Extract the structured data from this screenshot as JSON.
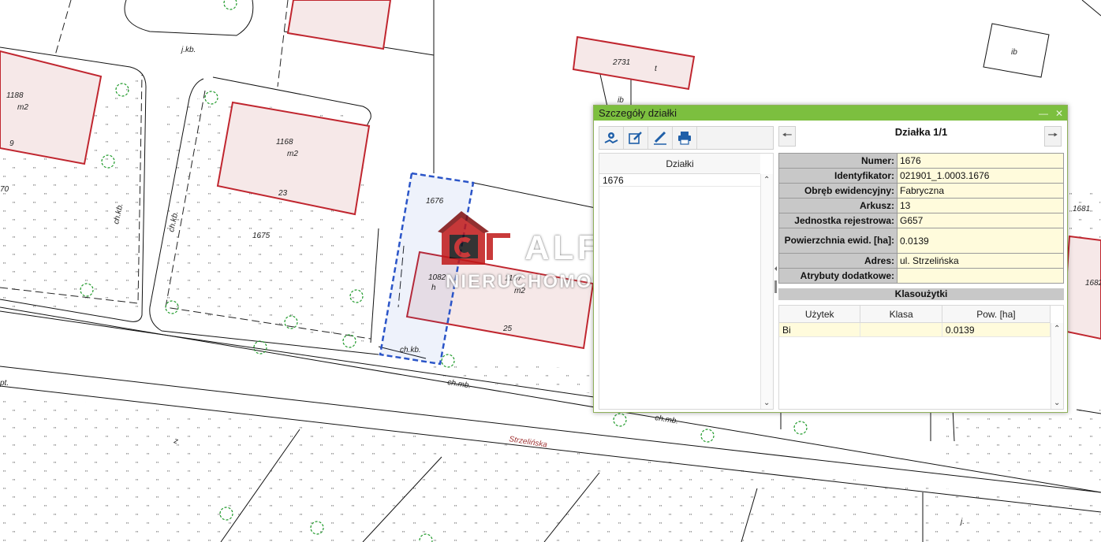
{
  "map": {
    "labels": {
      "jkb": "j.kb.",
      "p1188": "1188",
      "m2a": "m2",
      "n9": "9",
      "n70": "70",
      "p1168": "1168",
      "m2b": "m2",
      "n23": "23",
      "p1675": "1675",
      "chkb1": "ch.kb.",
      "chkb2": "ch.kb.",
      "p1676": "1676",
      "p1082": "1082",
      "h": "h",
      "p1167": "1167",
      "m2c": "m2",
      "n25": "25",
      "chkb3": "ch.kb.",
      "chmb1": "ch.mb.",
      "chmb2": "ch.mb.",
      "p2731": "2731",
      "t": "t",
      "ib1": "ib",
      "ib2": "ib",
      "p1681": "1681",
      "p1682": "1682",
      "pt": "pt.",
      "z": "z",
      "street": "Strzelińska",
      "j": "j."
    },
    "colors": {
      "building_fill": "#f6e8e8",
      "building_stroke": "#c0262f",
      "selection": "#2b55c8",
      "tree": "#1f9a2a",
      "street_label": "#a03535"
    }
  },
  "watermark": {
    "brand": "ALFA",
    "sub": "NIERUCHOMOŚCI"
  },
  "dialog": {
    "title": "Szczegóły działki",
    "toolbar": {
      "icons": [
        "locate-plot-icon",
        "edit-plot-icon",
        "pencil-icon",
        "print-icon"
      ]
    },
    "plots_list": {
      "header": "Działki",
      "items": [
        "1676"
      ]
    },
    "nav": {
      "title": "Działka 1/1"
    },
    "properties": [
      {
        "key": "Numer:",
        "value": "1676"
      },
      {
        "key": "Identyfikator:",
        "value": "021901_1.0003.1676"
      },
      {
        "key": "Obręb ewidencyjny:",
        "value": "Fabryczna"
      },
      {
        "key": "Arkusz:",
        "value": "13"
      },
      {
        "key": "Jednostka rejestrowa:",
        "value": "G657"
      },
      {
        "key": "Powierzchnia ewid. [ha]:",
        "value": "0.0139"
      },
      {
        "key": "Adres:",
        "value": "ul. Strzelińska"
      },
      {
        "key": "Atrybuty dodatkowe:",
        "value": ""
      }
    ],
    "klasouzytki": {
      "header": "Klasoużytki",
      "columns": [
        "Użytek",
        "Klasa",
        "Pow. [ha]"
      ],
      "rows": [
        {
          "uzytek": "Bi",
          "klasa": "",
          "pow": "0.0139"
        }
      ]
    }
  }
}
